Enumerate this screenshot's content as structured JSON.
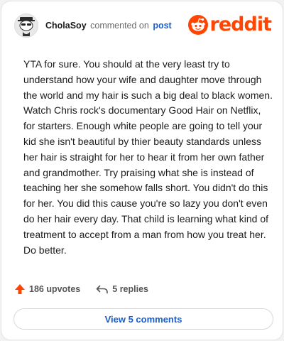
{
  "header": {
    "username": "CholaSoy",
    "verb": "commented on",
    "target": "post",
    "logo_text": "reddit"
  },
  "comment": {
    "text": "YTA for sure. You should at the very least try to understand how your wife and daughter move through the world and my hair is such a big deal to black women. Watch Chris rock's documentary Good Hair on Netflix, for starters. Enough white people are going to tell your kid she isn't beautiful by thier beauty standards unless her hair is straight for her to hear it from her own father and grandmother. Try praising what she is instead of teaching her she somehow falls short. You didn't do this for her. You did this cause you're so lazy you don't even do her hair every day. That child is learning what kind of treatment to accept from a man from how you treat her. Do better."
  },
  "actions": {
    "upvotes": "186 upvotes",
    "replies": "5 replies"
  },
  "footer": {
    "view_comments": "View 5 comments"
  },
  "colors": {
    "brand": "#ff4500",
    "link": "#1a5fc9",
    "upvote": "#ff4500"
  },
  "icons": {
    "avatar": "snoo-avatar",
    "logo": "reddit-snoo-icon",
    "upvote": "upvote-arrow-icon",
    "reply": "reply-arrow-icon"
  }
}
